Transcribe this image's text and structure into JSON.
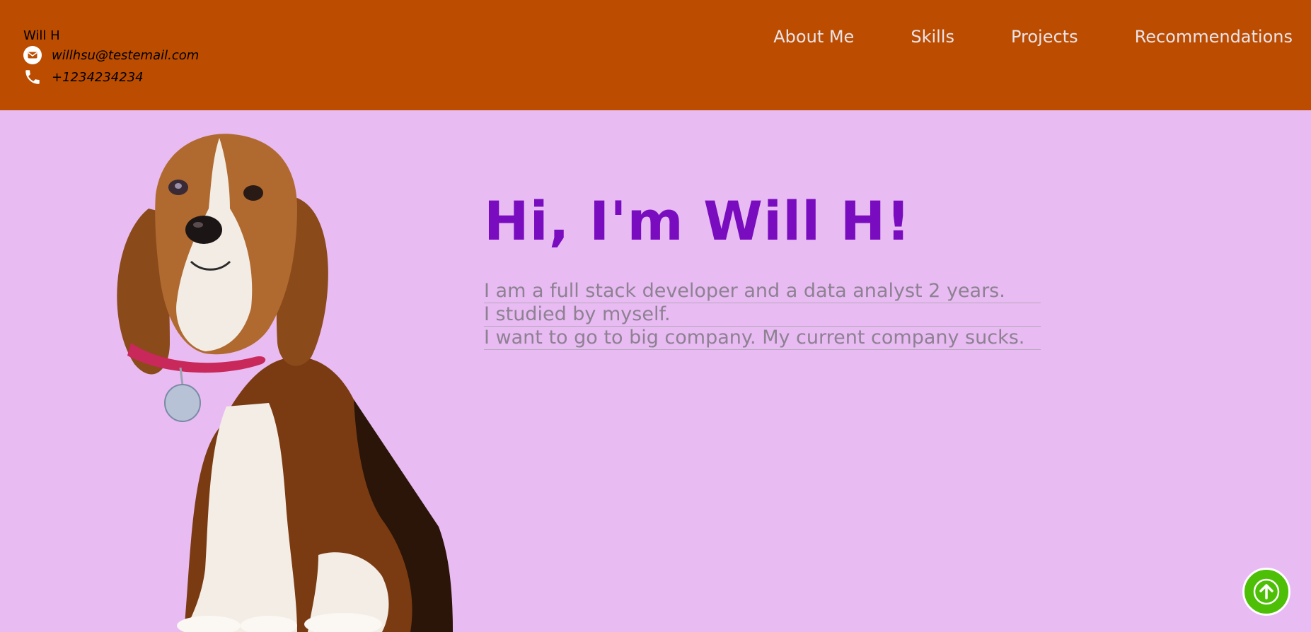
{
  "header": {
    "name": "Will H",
    "email": "willhsu@testemail.com",
    "phone": "+1234234234",
    "email_icon": "email-icon",
    "phone_icon": "phone-icon"
  },
  "nav": {
    "items": [
      {
        "label": "About Me"
      },
      {
        "label": "Skills"
      },
      {
        "label": "Projects"
      },
      {
        "label": "Recommendations"
      }
    ]
  },
  "hero": {
    "title": "Hi, I'm Will H!",
    "image": "beagle-dog-photo",
    "bio_lines": [
      "I am a full stack developer and a data analyst 2 years.",
      "I studied by myself.",
      "I want to go to big company. My current company sucks."
    ]
  },
  "scroll_top": {
    "icon": "arrow-up-icon"
  },
  "colors": {
    "header_bg": "#bc4d00",
    "page_bg": "#e8bbf2",
    "title": "#7a0cbf",
    "bio_text": "#8d8192",
    "nav_text": "#ece4ea",
    "scroll_button": "#4cbf06"
  }
}
